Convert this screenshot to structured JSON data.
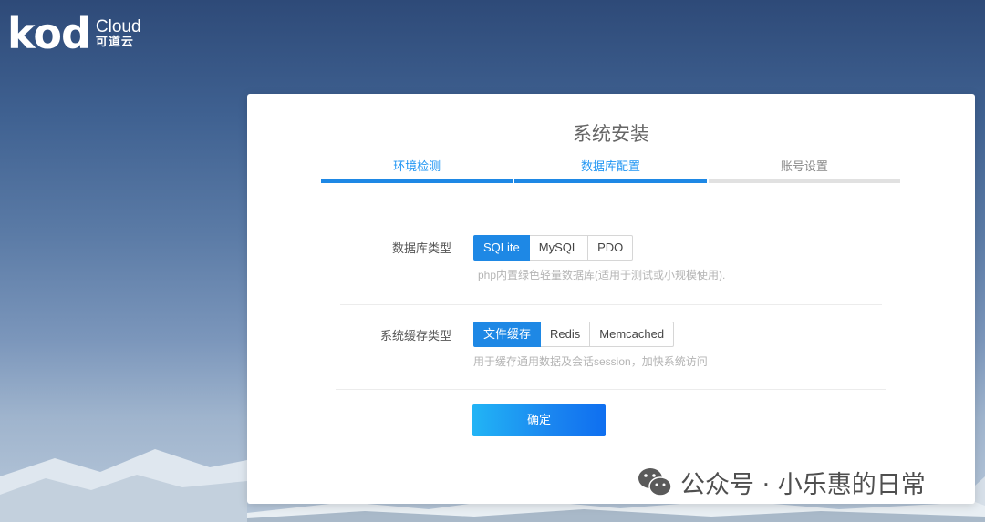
{
  "brand": {
    "mark": "kod",
    "cloud": "Cloud",
    "cn_name": "可道云"
  },
  "install": {
    "title": "系统安装",
    "steps": [
      {
        "label": "环境检测",
        "state": "active"
      },
      {
        "label": "数据库配置",
        "state": "active"
      },
      {
        "label": "账号设置",
        "state": "pending"
      }
    ],
    "db_type": {
      "label": "数据库类型",
      "options": [
        "SQLite",
        "MySQL",
        "PDO"
      ],
      "selected": "SQLite",
      "hint": "php内置绿色轻量数据库(适用于测试或小规模使用)."
    },
    "cache_type": {
      "label": "系统缓存类型",
      "options": [
        "文件缓存",
        "Redis",
        "Memcached"
      ],
      "selected": "文件缓存",
      "hint": "用于缓存通用数据及会话session，加快系统访问"
    },
    "confirm_label": "确定"
  },
  "watermark": {
    "text": "公众号 · 小乐惠的日常"
  },
  "colors": {
    "accent": "#1e88e5",
    "step_pending": "#e1e1e1",
    "hint": "#b4b4b4"
  }
}
